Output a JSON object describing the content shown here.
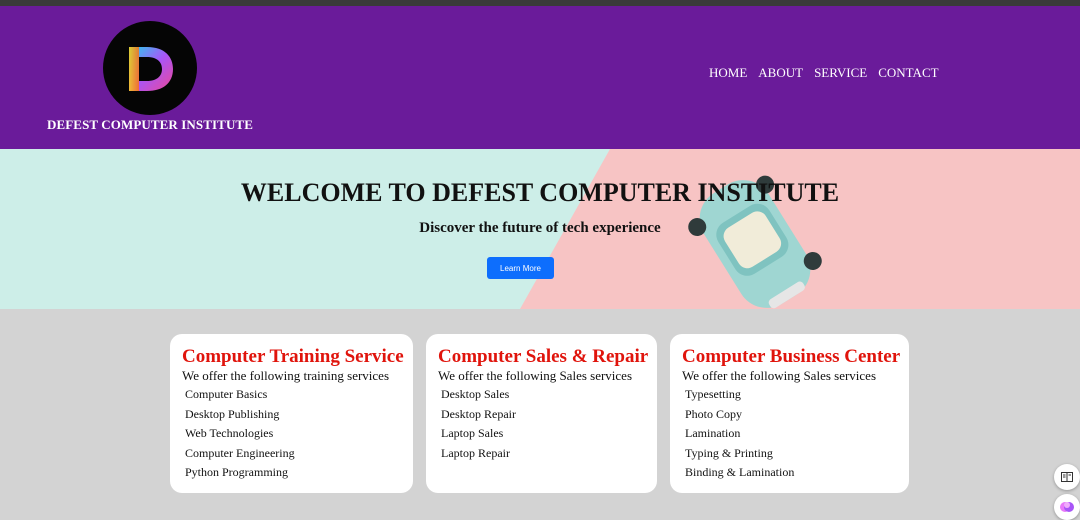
{
  "header": {
    "brand": "DEFEST COMPUTER INSTITUTE",
    "logo_icon": "d-letter-logo",
    "nav": [
      {
        "label": "HOME"
      },
      {
        "label": "ABOUT"
      },
      {
        "label": "SERVICE"
      },
      {
        "label": "CONTACT"
      }
    ]
  },
  "hero": {
    "title": "WELCOME TO DEFEST COMPUTER INSTITUTE",
    "subtitle": "Discover the future of tech experience",
    "button_label": "Learn More"
  },
  "cards": [
    {
      "title": "Computer Training Service",
      "intro": "We offer the following training services",
      "items": [
        "Computer Basics",
        "Desktop Publishing",
        "Web Technologies",
        "Computer Engineering",
        "Python Programming"
      ]
    },
    {
      "title": "Computer Sales & Repair",
      "intro": "We offer the following Sales services",
      "items": [
        "Desktop Sales",
        "Desktop Repair",
        "Laptop Sales",
        "Laptop Repair"
      ]
    },
    {
      "title": "Computer Business Center",
      "intro": "We offer the following Sales services",
      "items": [
        "Typesetting",
        "Photo Copy",
        "Lamination",
        "Typing & Printing",
        "Binding & Lamination"
      ]
    }
  ],
  "colors": {
    "header_bg": "#6a1b9a",
    "page_bg": "#d3d3d3",
    "card_title": "#e0140c",
    "button": "#0d6efd"
  },
  "floating_icons": [
    "reader-icon",
    "brain-icon"
  ]
}
